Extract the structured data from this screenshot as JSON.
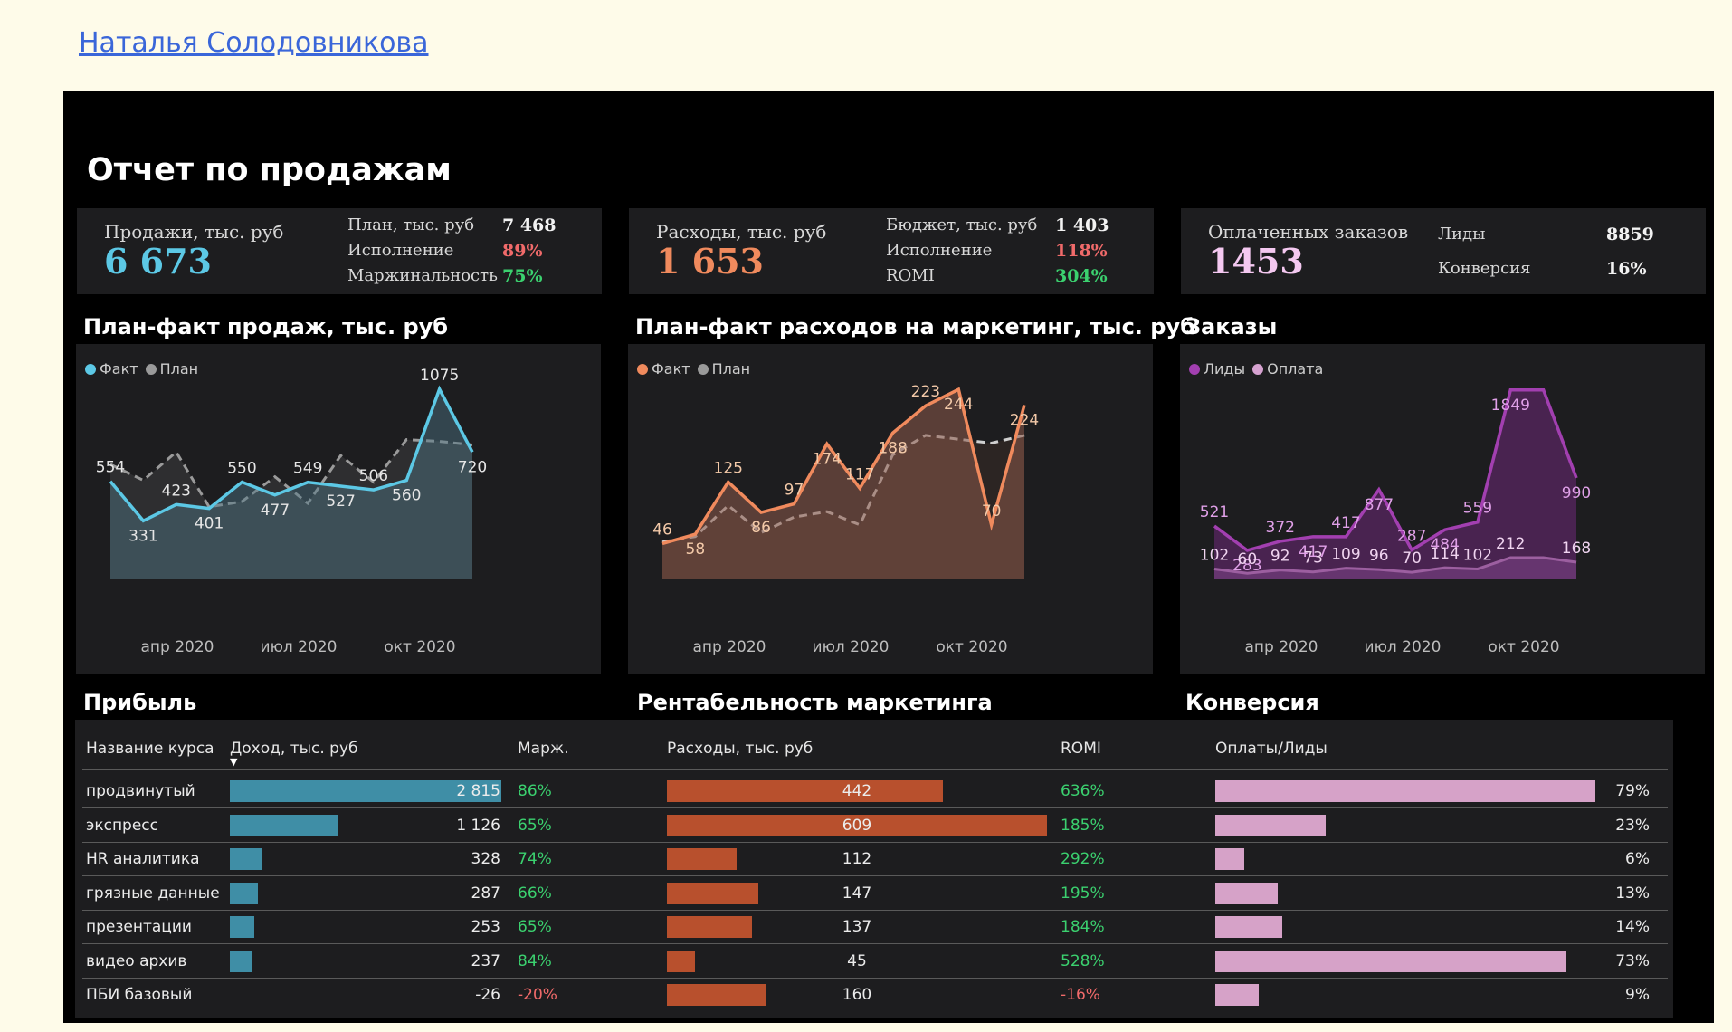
{
  "author": "Наталья Солодовникова",
  "dashboard_title": "Отчет по продажам",
  "colors": {
    "sales": "#5cc8e5",
    "costs": "#f08a5d",
    "leads": "#a23fb0",
    "pay": "#d6a2d0",
    "green": "#3bd16f",
    "red": "#f06a6a"
  },
  "kpi": {
    "sales": {
      "label": "Продажи, тыс. руб",
      "value": "6 673",
      "rows": [
        {
          "label": "План, тыс. руб",
          "value": "7 468"
        },
        {
          "label": "Исполнение",
          "value": "89%"
        },
        {
          "label": "Маржинальность",
          "value": "75%"
        }
      ]
    },
    "costs": {
      "label": "Расходы, тыс. руб",
      "value": "1 653",
      "rows": [
        {
          "label": "Бюджет, тыс. руб",
          "value": "1 403"
        },
        {
          "label": "Исполнение",
          "value": "118%"
        },
        {
          "label": "ROMI",
          "value": "304%"
        }
      ]
    },
    "orders": {
      "label": "Оплаченных заказов",
      "value": "1453",
      "rows": [
        {
          "label": "Лиды",
          "value": "8859"
        },
        {
          "label": "Конверсия",
          "value": "16%"
        }
      ]
    }
  },
  "sections": {
    "sales_chart": "План-факт продаж, тыс. руб",
    "costs_chart": "План-факт расходов на маркетинг, тыс. руб",
    "orders_chart": "Заказы",
    "profit": "Прибыль",
    "romi": "Рентабельность маркетинга",
    "conversion": "Конверсия"
  },
  "legends": {
    "sales": [
      "Факт",
      "План"
    ],
    "costs": [
      "Факт",
      "План"
    ],
    "orders": [
      "Лиды",
      "Оплата"
    ]
  },
  "chart_data": [
    {
      "type": "area",
      "title": "План-факт продаж, тыс. руб",
      "x_ticks": [
        "апр 2020",
        "июл 2020",
        "окт 2020"
      ],
      "ylim": [
        0,
        1100
      ],
      "series": [
        {
          "name": "Факт",
          "values": [
            554,
            331,
            423,
            401,
            550,
            477,
            549,
            527,
            506,
            560,
            1075,
            720
          ]
        },
        {
          "name": "План",
          "values": [
            650,
            560,
            720,
            410,
            440,
            580,
            430,
            700,
            550,
            790,
            780,
            760
          ]
        }
      ]
    },
    {
      "type": "area",
      "title": "План-факт расходов на маркетинг, тыс. руб",
      "x_ticks": [
        "апр 2020",
        "июл 2020",
        "окт 2020"
      ],
      "ylim": [
        0,
        250
      ],
      "series": [
        {
          "name": "Факт",
          "values": [
            46,
            58,
            125,
            86,
            97,
            174,
            117,
            188,
            223,
            244,
            70,
            224
          ]
        },
        {
          "name": "План",
          "values": [
            48,
            55,
            95,
            60,
            80,
            87,
            70,
            160,
            185,
            180,
            175,
            185
          ]
        }
      ]
    },
    {
      "type": "area",
      "title": "Заказы",
      "x_ticks": [
        "апр 2020",
        "июл 2020",
        "окт 2020"
      ],
      "ylim": [
        0,
        1900
      ],
      "series": [
        {
          "name": "Лиды",
          "values": [
            521,
            283,
            372,
            417,
            417,
            877,
            287,
            484,
            559,
            1849,
            1849,
            990
          ]
        },
        {
          "name": "Оплата",
          "values": [
            102,
            60,
            92,
            73,
            109,
            96,
            70,
            114,
            102,
            212,
            212,
            168
          ]
        }
      ]
    }
  ],
  "table": {
    "headers": {
      "course": "Название курса",
      "income": "Доход, тыс. руб",
      "margin": "Марж.",
      "costs": "Расходы, тыс. руб",
      "romi": "ROMI",
      "conv": "Оплаты/Лиды"
    },
    "sort_icon": "sort-desc-icon",
    "rows": [
      {
        "course": "продвинутый",
        "income": "2 815",
        "income_v": 2815,
        "margin": "86%",
        "costs": "442",
        "costs_v": 442,
        "romi": "636%",
        "conv": "79%",
        "conv_v": 79
      },
      {
        "course": "экспресс",
        "income": "1 126",
        "income_v": 1126,
        "margin": "65%",
        "costs": "609",
        "costs_v": 609,
        "romi": "185%",
        "conv": "23%",
        "conv_v": 23
      },
      {
        "course": "HR аналитика",
        "income": "328",
        "income_v": 328,
        "margin": "74%",
        "costs": "112",
        "costs_v": 112,
        "romi": "292%",
        "conv": "6%",
        "conv_v": 6
      },
      {
        "course": "грязные данные",
        "income": "287",
        "income_v": 287,
        "margin": "66%",
        "costs": "147",
        "costs_v": 147,
        "romi": "195%",
        "conv": "13%",
        "conv_v": 13
      },
      {
        "course": "презентации",
        "income": "253",
        "income_v": 253,
        "margin": "65%",
        "costs": "137",
        "costs_v": 137,
        "romi": "184%",
        "conv": "14%",
        "conv_v": 14
      },
      {
        "course": "видео архив",
        "income": "237",
        "income_v": 237,
        "margin": "84%",
        "costs": "45",
        "costs_v": 45,
        "romi": "528%",
        "conv": "73%",
        "conv_v": 73
      },
      {
        "course": "ПБИ базовый",
        "income": "-26",
        "income_v": -26,
        "margin": "-20%",
        "costs": "160",
        "costs_v": 160,
        "romi": "-16%",
        "conv": "9%",
        "conv_v": 9
      }
    ]
  }
}
